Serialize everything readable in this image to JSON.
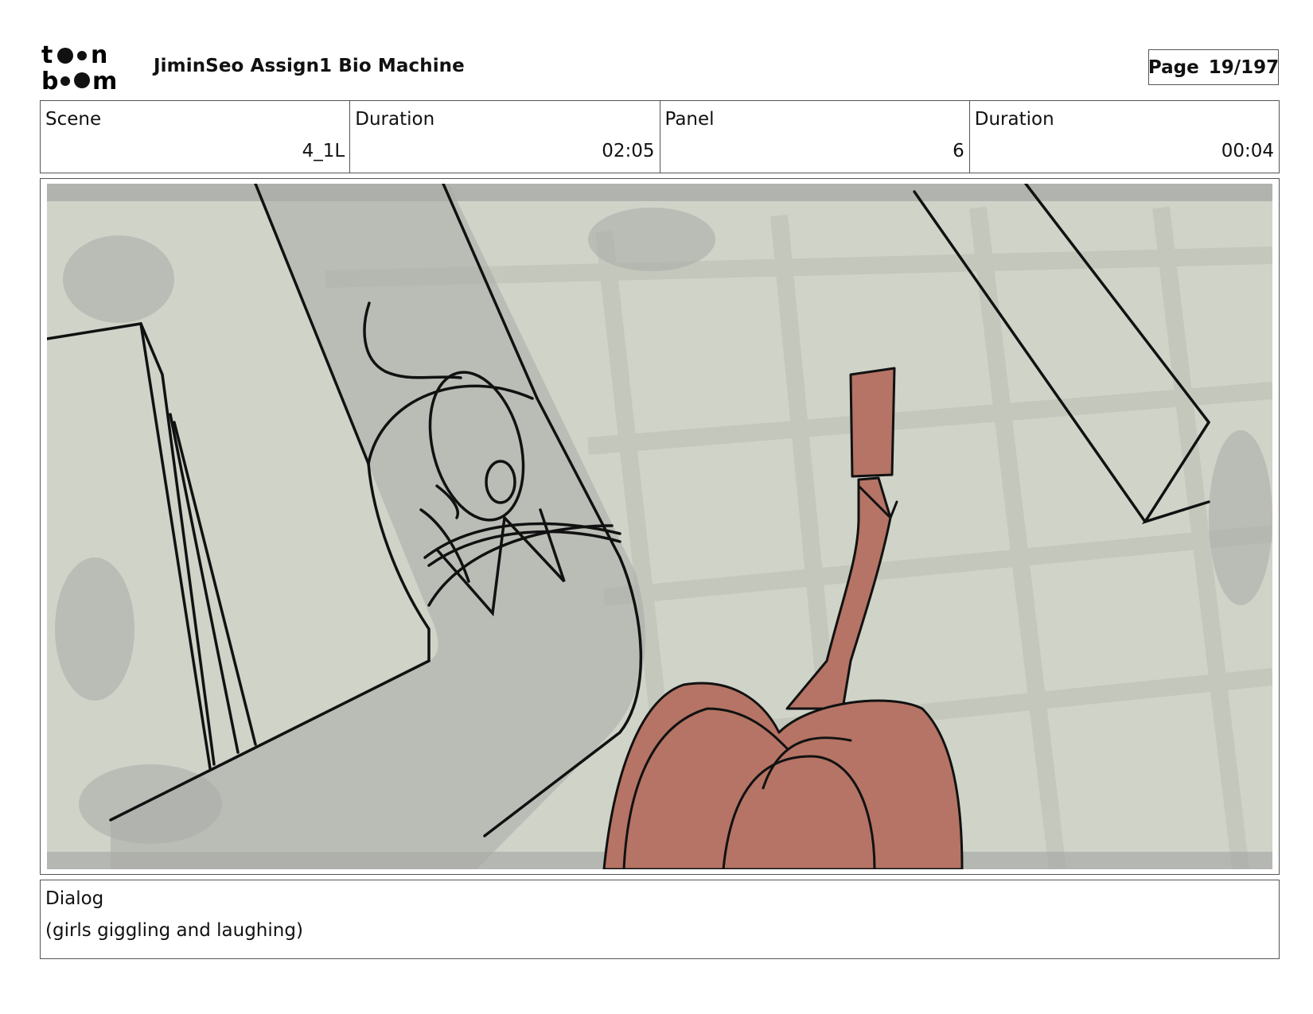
{
  "header": {
    "logo_text_top": "toon",
    "logo_text_bottom": "boom",
    "project_title": "JiminSeo Assign1 Bio Machine",
    "page_label": "Page",
    "page_number": "19/197"
  },
  "info": {
    "scene_label": "Scene",
    "scene_value": "4_1L",
    "scene_duration_label": "Duration",
    "scene_duration_value": "02:05",
    "panel_label": "Panel",
    "panel_value": "6",
    "panel_duration_label": "Duration",
    "panel_duration_value": "00:04"
  },
  "dialog": {
    "label": "Dialog",
    "text": "(girls giggling and laughing)"
  },
  "colors": {
    "background_wash": "#cfd3c8",
    "shadow_gray": "#a9aba8",
    "character_fill": "#b57465",
    "line": "#111111"
  }
}
